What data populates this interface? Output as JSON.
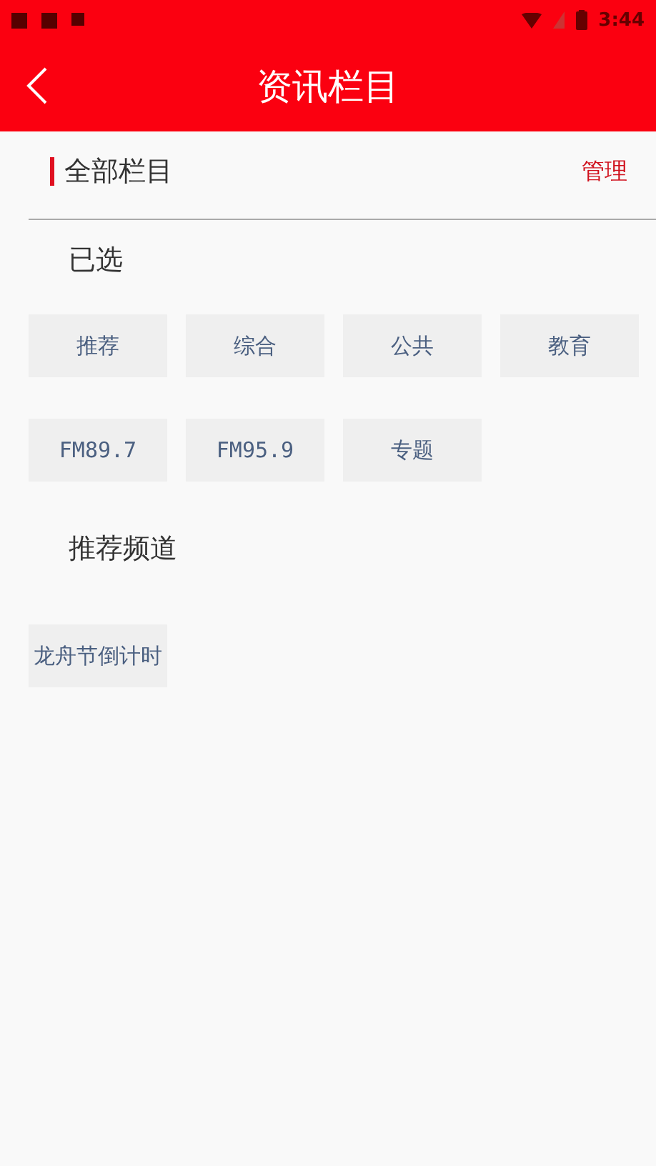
{
  "status_bar": {
    "time": "3:44"
  },
  "header": {
    "title": "资讯栏目"
  },
  "section": {
    "title": "全部栏目",
    "action": "管理"
  },
  "selected_group": {
    "title": "已选",
    "channels": [
      {
        "label": "推荐"
      },
      {
        "label": "综合"
      },
      {
        "label": "公共"
      },
      {
        "label": "教育"
      },
      {
        "label": "FM89.7"
      },
      {
        "label": "FM95.9"
      },
      {
        "label": "专题"
      }
    ]
  },
  "recommended_group": {
    "title": "推荐频道",
    "channels": [
      {
        "label": "龙舟节倒计时"
      }
    ]
  }
}
